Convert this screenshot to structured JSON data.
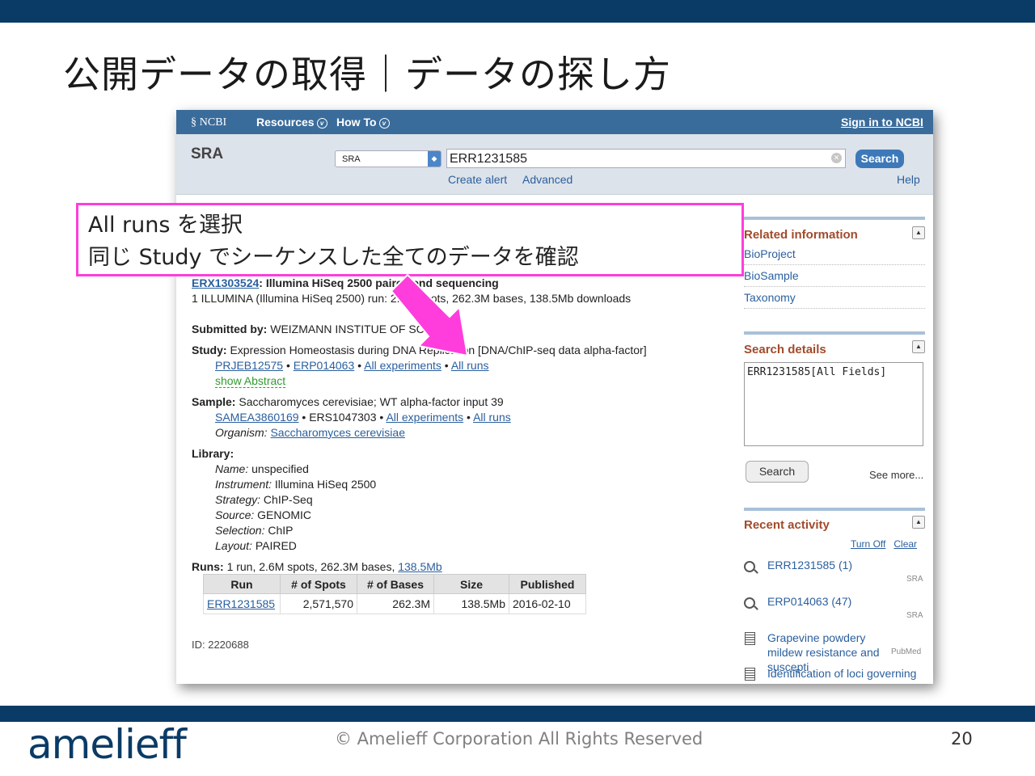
{
  "slide": {
    "title": "公開データの取得｜データの探し方",
    "logo": "amelieff",
    "copyright": "© Amelieff Corporation All Rights Reserved",
    "page_number": "20"
  },
  "callout": {
    "line1": "All runs を選択",
    "line2": "同じ Study でシーケンスした全てのデータを確認"
  },
  "ncbi": {
    "logo_label": "NCBI",
    "nav": {
      "resources": "Resources",
      "howto": "How To",
      "signin": "Sign in to NCBI"
    },
    "db_name": "SRA",
    "db_select": "SRA",
    "query": "ERR1231585",
    "search_button": "Search",
    "create_alert": "Create alert",
    "advanced": "Advanced",
    "help": "Help"
  },
  "record": {
    "experiment_id": "ERX1303524",
    "experiment_title": ": Illumina HiSeq 2500 paired end sequencing",
    "summary": "1 ILLUMINA (Illumina HiSeq 2500) run: 2.6M spots, 262.3M bases, 138.5Mb downloads",
    "submitted_label": "Submitted by:",
    "submitted_value": "WEIZMANN INSTITUE OF SCIENCE",
    "study_label": "Study:",
    "study_value": "Expression Homeostasis during DNA Replication [DNA/ChIP-seq data alpha-factor]",
    "study_links": [
      "PRJEB12575",
      "ERP014063",
      "All experiments",
      "All runs"
    ],
    "show_abstract": "show Abstract",
    "sample_label": "Sample:",
    "sample_value": "Saccharomyces cerevisiae; WT alpha-factor input 39",
    "sample_id": "SAMEA3860169",
    "sample_ers": "ERS1047303",
    "sample_links": [
      "All experiments",
      "All runs"
    ],
    "organism_label": "Organism:",
    "organism_value": "Saccharomyces cerevisiae",
    "library_label": "Library:",
    "library": [
      {
        "key": "Name:",
        "value": "unspecified"
      },
      {
        "key": "Instrument:",
        "value": "Illumina HiSeq 2500"
      },
      {
        "key": "Strategy:",
        "value": "ChIP-Seq"
      },
      {
        "key": "Source:",
        "value": "GENOMIC"
      },
      {
        "key": "Selection:",
        "value": "ChIP"
      },
      {
        "key": "Layout:",
        "value": "PAIRED"
      }
    ],
    "runs_label": "Runs:",
    "runs_value": "1 run, 2.6M spots, 262.3M bases,",
    "runs_size_link": "138.5Mb",
    "runs_table": {
      "headers": [
        "Run",
        "# of Spots",
        "# of Bases",
        "Size",
        "Published"
      ],
      "row": [
        "ERR1231585",
        "2,571,570",
        "262.3M",
        "138.5Mb",
        "2016-02-10"
      ]
    },
    "id_line": "ID: 2220688"
  },
  "sidebar": {
    "related_title": "Related information",
    "related_items": [
      "BioProject",
      "BioSample",
      "Taxonomy"
    ],
    "details_title": "Search details",
    "details_text": "ERR1231585[All Fields]",
    "details_search": "Search",
    "see_more": "See more...",
    "recent_title": "Recent activity",
    "turn_off": "Turn Off",
    "clear": "Clear",
    "recent": [
      {
        "text": "ERR1231585 (1)",
        "source": "SRA"
      },
      {
        "text": "ERP014063 (47)",
        "source": "SRA"
      },
      {
        "text": "Grapevine powdery mildew resistance and suscepti",
        "source": "PubMed"
      },
      {
        "text": "Identification of loci governing",
        "source": ""
      }
    ]
  }
}
